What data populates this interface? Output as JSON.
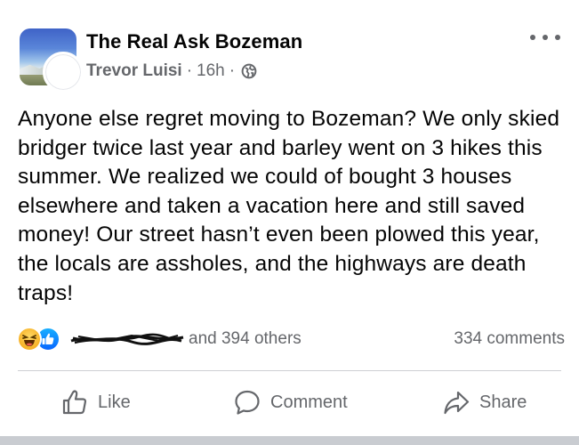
{
  "post": {
    "group_name": "The Real Ask Bozeman",
    "author": "Trevor Luisi",
    "time": "16h",
    "separator": "·",
    "menu_icon": "more-horizontal-icon",
    "privacy_icon": "globe-icon",
    "body": "Anyone else regret moving to Bozeman? We only skied bridger twice last year and barley went on 3 hikes this summer. We realized we could of bought 3 houses elsewhere and taken a vacation here and still saved money! Our street hasn’t even been plowed this year, the locals are assholes, and the highways are death traps!"
  },
  "reactions": {
    "icons": [
      "haha-reaction-icon",
      "like-reaction-icon"
    ],
    "others_text": "and 394 others",
    "comments": "334 comments"
  },
  "actions": {
    "like": "Like",
    "comment": "Comment",
    "share": "Share"
  },
  "colors": {
    "text": "#050505",
    "secondary": "#65676b",
    "like_blue": "#0866ff",
    "haha_yellow": "#f7b125"
  }
}
